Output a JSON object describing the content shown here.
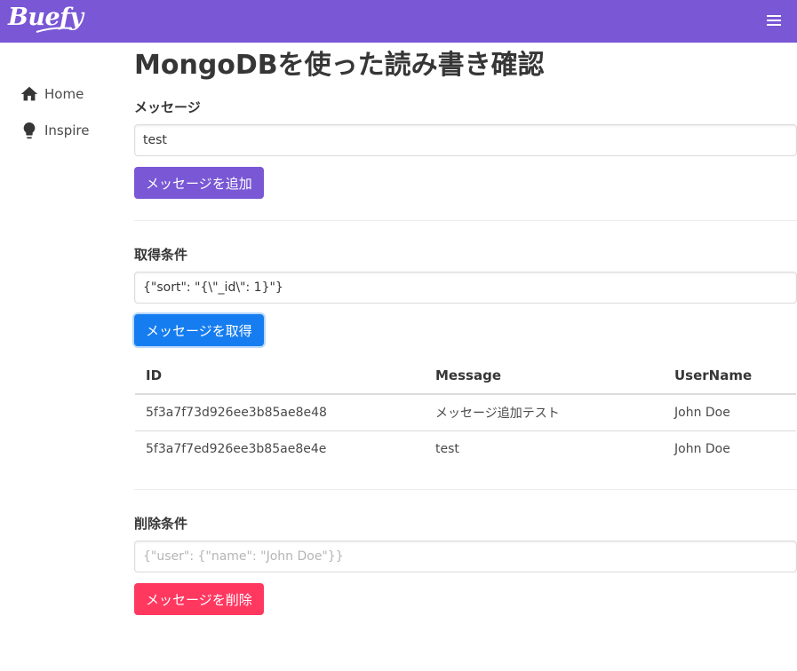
{
  "navbar": {
    "brand": "Buefy",
    "menu_icon": "hamburger-icon",
    "color": "#7957d5"
  },
  "sidebar": {
    "items": [
      {
        "label": "Home",
        "icon": "home-icon"
      },
      {
        "label": "Inspire",
        "icon": "lightbulb-icon"
      }
    ]
  },
  "page": {
    "title": "MongoDBを使った読み書き確認"
  },
  "add_section": {
    "label": "メッセージ",
    "input_value": "test",
    "button": "メッセージを追加"
  },
  "get_section": {
    "label": "取得条件",
    "input_value": "{\"sort\": \"{\\\"_id\\\": 1}\"}",
    "button": "メッセージを取得"
  },
  "table": {
    "columns": [
      "ID",
      "Message",
      "UserName"
    ],
    "rows": [
      [
        "5f3a7f73d926ee3b85ae8e48",
        "メッセージ追加テスト",
        "John Doe"
      ],
      [
        "5f3a7f7ed926ee3b85ae8e4e",
        "test",
        "John Doe"
      ]
    ]
  },
  "delete_section": {
    "label": "削除条件",
    "input_placeholder": "{\"user\": {\"name\": \"John Doe\"}}",
    "button": "メッセージを削除"
  },
  "colors": {
    "primary": "#7957d5",
    "info": "#167df0",
    "danger": "#ff3860"
  }
}
